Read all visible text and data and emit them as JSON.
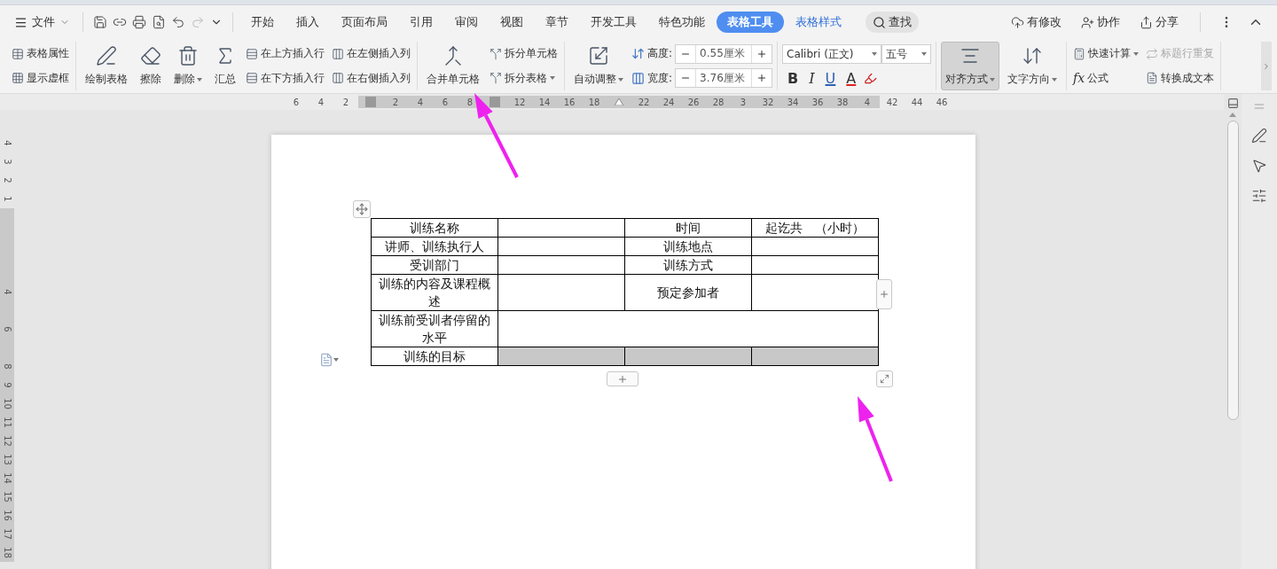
{
  "menu_bar": {
    "file_menu": "文件",
    "tabs": [
      {
        "label": "开始",
        "selected": false,
        "contextual": false
      },
      {
        "label": "插入",
        "selected": false,
        "contextual": false
      },
      {
        "label": "页面布局",
        "selected": false,
        "contextual": false
      },
      {
        "label": "引用",
        "selected": false,
        "contextual": false
      },
      {
        "label": "审阅",
        "selected": false,
        "contextual": false
      },
      {
        "label": "视图",
        "selected": false,
        "contextual": false
      },
      {
        "label": "章节",
        "selected": false,
        "contextual": false
      },
      {
        "label": "开发工具",
        "selected": false,
        "contextual": false
      },
      {
        "label": "特色功能",
        "selected": false,
        "contextual": false
      },
      {
        "label": "表格工具",
        "selected": true,
        "contextual": true
      },
      {
        "label": "表格样式",
        "selected": false,
        "contextual": true
      }
    ],
    "search": "查找",
    "actions": [
      "有修改",
      "协作",
      "分享"
    ]
  },
  "ribbon": {
    "groups": [
      {
        "columns": [
          {
            "kind": "stack",
            "items": [
              {
                "label": "表格属性",
                "dropdown": false,
                "disabled": false
              },
              {
                "label": "显示虚框",
                "dropdown": false,
                "disabled": false
              }
            ]
          }
        ]
      },
      {
        "columns": [
          {
            "kind": "large",
            "items": [
              {
                "label": "绘制表格",
                "dropdown": false,
                "disabled": false,
                "selected": false
              }
            ]
          },
          {
            "kind": "large",
            "items": [
              {
                "label": "擦除",
                "dropdown": false,
                "disabled": false,
                "selected": false
              }
            ]
          },
          {
            "kind": "large",
            "items": [
              {
                "label": "删除",
                "dropdown": true,
                "disabled": false,
                "selected": false
              }
            ]
          },
          {
            "kind": "large",
            "items": [
              {
                "label": "汇总",
                "dropdown": false,
                "disabled": false,
                "selected": false
              }
            ]
          },
          {
            "kind": "stack",
            "items": [
              {
                "label": "在上方插入行",
                "dropdown": false,
                "disabled": false
              },
              {
                "label": "在下方插入行",
                "dropdown": false,
                "disabled": false
              }
            ]
          },
          {
            "kind": "stack",
            "items": [
              {
                "label": "在左侧插入列",
                "dropdown": false,
                "disabled": false
              },
              {
                "label": "在右侧插入列",
                "dropdown": false,
                "disabled": false
              }
            ]
          }
        ]
      },
      {
        "columns": [
          {
            "kind": "large",
            "items": [
              {
                "label": "合并单元格",
                "dropdown": false,
                "disabled": false,
                "selected": false
              }
            ]
          },
          {
            "kind": "stack",
            "items": [
              {
                "label": "拆分单元格",
                "dropdown": false,
                "disabled": false
              },
              {
                "label": "拆分表格",
                "dropdown": true,
                "disabled": false
              }
            ]
          }
        ]
      },
      {
        "columns": [
          {
            "kind": "large",
            "items": [
              {
                "label": "自动调整",
                "dropdown": true,
                "disabled": false,
                "selected": false
              }
            ]
          }
        ],
        "size_fields": [
          {
            "label": "高度:",
            "value": "0.55厘米"
          },
          {
            "label": "宽度:",
            "value": "3.76厘米"
          }
        ]
      },
      {
        "font": {
          "family": "Calibri (正文)",
          "size": "五号",
          "styles": [
            "B",
            "I",
            "U",
            "A"
          ]
        }
      },
      {
        "columns": [
          {
            "kind": "large",
            "items": [
              {
                "label": "对齐方式",
                "dropdown": true,
                "disabled": false,
                "selected": true
              }
            ]
          },
          {
            "kind": "large",
            "items": [
              {
                "label": "文字方向",
                "dropdown": true,
                "disabled": false,
                "selected": false
              }
            ]
          }
        ]
      },
      {
        "columns": [
          {
            "kind": "stack",
            "items": [
              {
                "label": "快速计算",
                "dropdown": true,
                "disabled": false
              },
              {
                "label": "公式",
                "glyph": "fx",
                "dropdown": false,
                "disabled": false
              }
            ]
          },
          {
            "kind": "stack",
            "items": [
              {
                "label": "标题行重复",
                "dropdown": false,
                "disabled": true
              },
              {
                "label": "转换成文本",
                "dropdown": false,
                "disabled": false
              }
            ]
          }
        ]
      }
    ]
  },
  "ruler": {
    "top": [
      {
        "kind": "num",
        "text": "6",
        "band": false
      },
      {
        "kind": "num",
        "text": "4",
        "band": false
      },
      {
        "kind": "num",
        "text": "2",
        "band": false
      },
      {
        "kind": "marker",
        "band": true
      },
      {
        "kind": "num",
        "text": "2",
        "band": true
      },
      {
        "kind": "num",
        "text": "4",
        "band": true
      },
      {
        "kind": "num",
        "text": "6",
        "band": true
      },
      {
        "kind": "num",
        "text": "8",
        "band": true
      },
      {
        "kind": "marker",
        "band": true
      },
      {
        "kind": "num",
        "text": "12",
        "band": true
      },
      {
        "kind": "num",
        "text": "14",
        "band": true
      },
      {
        "kind": "num",
        "text": "16",
        "band": true
      },
      {
        "kind": "num",
        "text": "18",
        "band": true
      },
      {
        "kind": "indent",
        "band": true
      },
      {
        "kind": "num",
        "text": "22",
        "band": true
      },
      {
        "kind": "num",
        "text": "24",
        "band": true
      },
      {
        "kind": "num",
        "text": "26",
        "band": true
      },
      {
        "kind": "num",
        "text": "28",
        "band": true
      },
      {
        "kind": "num",
        "text": "3",
        "band": true
      },
      {
        "kind": "num",
        "text": "32",
        "band": true
      },
      {
        "kind": "num",
        "text": "34",
        "band": true
      },
      {
        "kind": "num",
        "text": "36",
        "band": true
      },
      {
        "kind": "num",
        "text": "38",
        "band": true
      },
      {
        "kind": "num",
        "text": "4",
        "band": true
      },
      {
        "kind": "num",
        "text": "42",
        "band": false
      },
      {
        "kind": "num",
        "text": "44",
        "band": false
      },
      {
        "kind": "num",
        "text": "46",
        "band": false
      }
    ],
    "left": [
      {
        "kind": "num",
        "text": "4",
        "band": false
      },
      {
        "kind": "num",
        "text": "3",
        "band": false
      },
      {
        "kind": "num",
        "text": "2",
        "band": false
      },
      {
        "kind": "num",
        "text": "1",
        "band": false
      },
      {
        "kind": "blank",
        "band": true
      },
      {
        "kind": "blank",
        "band": true
      },
      {
        "kind": "blank",
        "band": true
      },
      {
        "kind": "blank",
        "band": true
      },
      {
        "kind": "num",
        "text": "4",
        "band": true
      },
      {
        "kind": "blank",
        "band": true
      },
      {
        "kind": "num",
        "text": "6",
        "band": true
      },
      {
        "kind": "blank",
        "band": true
      },
      {
        "kind": "num",
        "text": "8",
        "band": true
      },
      {
        "kind": "num",
        "text": "9",
        "band": true
      },
      {
        "kind": "num",
        "text": "10",
        "band": true
      },
      {
        "kind": "num",
        "text": "11",
        "band": true
      },
      {
        "kind": "num",
        "text": "12",
        "band": true
      },
      {
        "kind": "num",
        "text": "13",
        "band": true
      },
      {
        "kind": "num",
        "text": "14",
        "band": true
      },
      {
        "kind": "num",
        "text": "15",
        "band": true
      },
      {
        "kind": "num",
        "text": "16",
        "band": true
      },
      {
        "kind": "num",
        "text": "17",
        "band": true
      },
      {
        "kind": "num",
        "text": "18",
        "band": true
      }
    ]
  },
  "table": {
    "rows": [
      {
        "cells": [
          {
            "text": "训练名称",
            "kind": "cell",
            "selected": false
          },
          {
            "kind": "cell",
            "selected": false
          },
          {
            "text": "时间",
            "kind": "cell",
            "selected": false
          },
          {
            "text": "起讫共　（小时）",
            "kind": "cell",
            "selected": false
          }
        ]
      },
      {
        "cells": [
          {
            "text": "讲师、训练执行人",
            "kind": "cell",
            "selected": false
          },
          {
            "kind": "cell",
            "selected": false
          },
          {
            "text": "训练地点",
            "kind": "cell",
            "selected": false
          },
          {
            "kind": "cell",
            "selected": false
          }
        ]
      },
      {
        "cells": [
          {
            "text": "受训部门",
            "kind": "cell",
            "selected": false
          },
          {
            "kind": "cell",
            "selected": false
          },
          {
            "text": "训练方式",
            "kind": "cell",
            "selected": false
          },
          {
            "kind": "cell",
            "selected": false
          }
        ]
      },
      {
        "cells": [
          {
            "text": "训练的内容及课程概述",
            "kind": "cell",
            "selected": false
          },
          {
            "kind": "cell",
            "selected": false
          },
          {
            "text": "预定参加者",
            "kind": "cell",
            "selected": false
          },
          {
            "kind": "cell",
            "selected": false
          }
        ]
      },
      {
        "cells": [
          {
            "text": "训练前受训者停留的水平",
            "kind": "cell",
            "selected": false
          },
          {
            "kind": "wide",
            "selected": false
          }
        ]
      },
      {
        "cells": [
          {
            "text": "训练的目标",
            "kind": "cell",
            "selected": false
          },
          {
            "kind": "cell",
            "selected": true
          },
          {
            "kind": "cell",
            "selected": true
          },
          {
            "kind": "cell",
            "selected": true
          }
        ]
      }
    ]
  }
}
